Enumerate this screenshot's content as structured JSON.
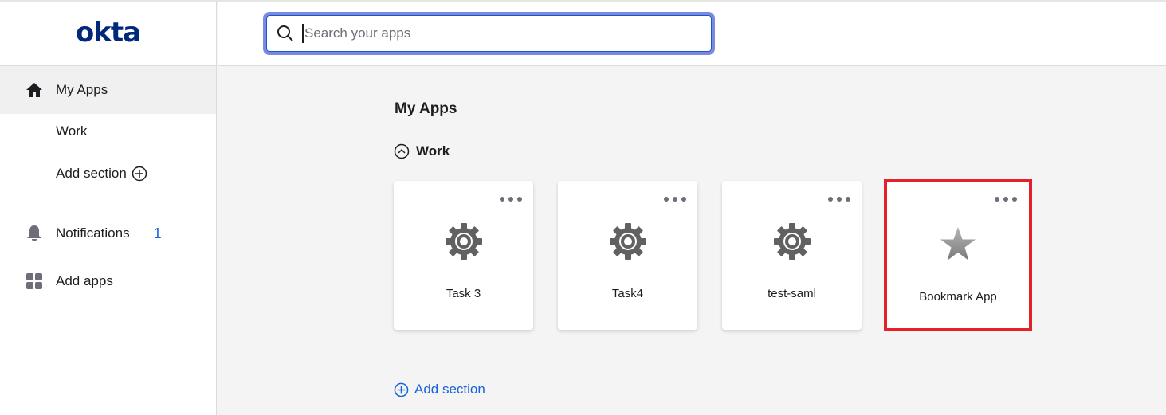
{
  "brand": {
    "logo_text": "okta",
    "color": "#00297a"
  },
  "search": {
    "placeholder": "Search your apps",
    "value": ""
  },
  "sidebar": {
    "items": [
      {
        "label": "My Apps",
        "icon": "home-icon",
        "active": true
      },
      {
        "label": "Work",
        "sub": true
      },
      {
        "label": "Add section",
        "sub": true,
        "icon": "plus-circle-icon"
      },
      {
        "label": "Notifications",
        "icon": "bell-icon",
        "badge": "1"
      },
      {
        "label": "Add apps",
        "icon": "grid-icon"
      }
    ]
  },
  "main": {
    "title": "My Apps",
    "section": {
      "name": "Work",
      "apps": [
        {
          "name": "Task 3",
          "icon": "gear-icon"
        },
        {
          "name": "Task4",
          "icon": "gear-icon"
        },
        {
          "name": "test-saml",
          "icon": "gear-icon"
        },
        {
          "name": "Bookmark App",
          "icon": "star-icon",
          "highlighted": true
        }
      ]
    },
    "add_section_label": "Add section"
  },
  "colors": {
    "accent": "#1662dd",
    "highlight": "#e4212b",
    "focus_ring": "#7a8ae0"
  }
}
